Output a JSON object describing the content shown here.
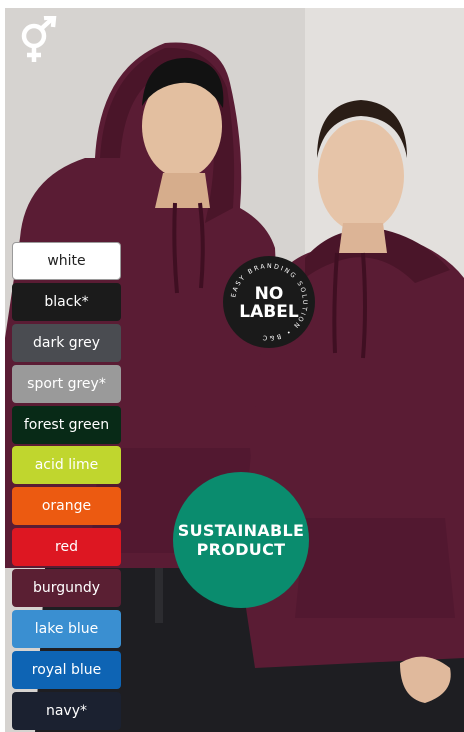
{
  "gender_icon": "unisex-symbol-icon",
  "swatches": [
    {
      "label": "white",
      "bg": "#ffffff",
      "fg": "#222222"
    },
    {
      "label": "black*",
      "bg": "#1b1b1b",
      "fg": "#ffffff"
    },
    {
      "label": "dark grey",
      "bg": "#4a4c51",
      "fg": "#ffffff"
    },
    {
      "label": "sport grey*",
      "bg": "#9a9a9a",
      "fg": "#ffffff"
    },
    {
      "label": "forest green",
      "bg": "#082a17",
      "fg": "#ffffff"
    },
    {
      "label": "acid lime",
      "bg": "#c0d62e",
      "fg": "#ffffff"
    },
    {
      "label": "orange",
      "bg": "#ec5a11",
      "fg": "#ffffff"
    },
    {
      "label": "red",
      "bg": "#dd1722",
      "fg": "#ffffff"
    },
    {
      "label": "burgundy",
      "bg": "#5a1f33",
      "fg": "#ffffff"
    },
    {
      "label": "lake blue",
      "bg": "#3a8fd1",
      "fg": "#ffffff"
    },
    {
      "label": "royal blue",
      "bg": "#0e64b4",
      "fg": "#ffffff"
    },
    {
      "label": "navy*",
      "bg": "#1b2130",
      "fg": "#ffffff"
    }
  ],
  "badge_nolabel": {
    "line1": "NO",
    "line2": "LABEL",
    "ring_text": "EASY BRANDING SOLUTION • B&C",
    "bg": "#1a1a1a"
  },
  "badge_sustainable": {
    "line1": "SUSTAINABLE",
    "line2": "PRODUCT",
    "bg": "#0a8c6e"
  },
  "colors": {
    "garment": "#5a1c34",
    "pants": "#1e1e22"
  }
}
